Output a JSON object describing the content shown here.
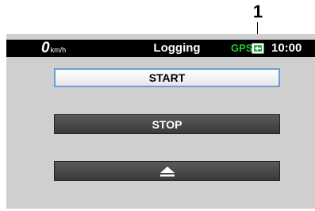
{
  "callout": {
    "number": "1"
  },
  "status_bar": {
    "speed_value": "0",
    "speed_unit": "km/h",
    "title": "Logging",
    "gps_label": "GPS",
    "card_icon": "sd-card-icon",
    "time": "10:00",
    "gps_color": "#22cc33"
  },
  "buttons": {
    "start_label": "START",
    "stop_label": "STOP",
    "eject_icon": "eject-icon"
  },
  "colors": {
    "screen_bg": "#cfcfcf",
    "start_border": "#6a9fd4",
    "dark_button": "#4a4a4a"
  }
}
